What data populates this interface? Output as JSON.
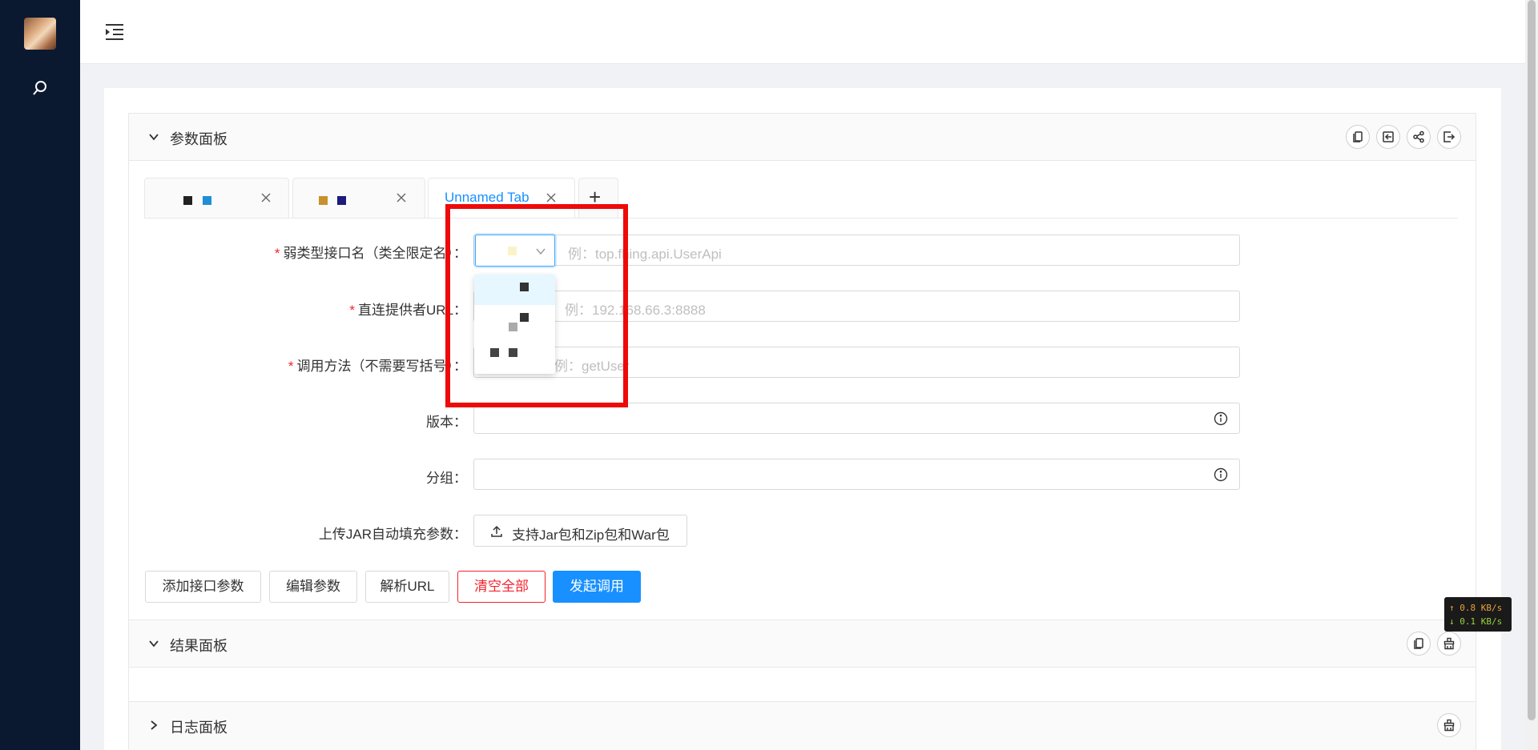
{
  "sidebar": {
    "avatar_alt": "user avatar",
    "search_icon": "search-icon"
  },
  "header": {
    "menu_icon": "menu-indent-icon"
  },
  "param_panel": {
    "title": "参数面板",
    "icons": [
      "copy-icon",
      "import-icon",
      "share-icon",
      "export-icon"
    ],
    "tabs": [
      {
        "label": "",
        "closable": true,
        "masked": true
      },
      {
        "label": "",
        "closable": true,
        "masked": true
      },
      {
        "label": "Unnamed Tab",
        "closable": true,
        "active": true
      }
    ],
    "add_tab_label": "+",
    "fields": {
      "interface": {
        "label": "弱类型接口名（类全限定名）：",
        "required": true,
        "placeholder": "例：top.fhing.api.UserApi",
        "select_value": ""
      },
      "provider_url": {
        "label": "直连提供者URL：",
        "required": true,
        "placeholder": "例：192.168.66.3:8888"
      },
      "method": {
        "label": "调用方法（不需要写括号）：",
        "required": true,
        "placeholder": "例：getUser"
      },
      "version": {
        "label": "版本：",
        "placeholder": ""
      },
      "group": {
        "label": "分组：",
        "placeholder": ""
      },
      "upload": {
        "label": "上传JAR自动填充参数：",
        "button": "支持Jar包和Zip包和War包"
      }
    },
    "dropdown_options": [
      "",
      "",
      ""
    ],
    "buttons": {
      "add_param": "添加接口参数",
      "edit_param": "编辑参数",
      "parse_url": "解析URL",
      "clear_all": "清空全部",
      "invoke": "发起调用"
    }
  },
  "result_panel": {
    "title": "结果面板",
    "icons": [
      "copy-icon",
      "clear-icon"
    ]
  },
  "log_panel": {
    "title": "日志面板",
    "icons": [
      "clear-icon"
    ]
  },
  "net_speed": {
    "up": "↑ 0.8 KB/s",
    "down": "↓ 0.1 KB/s"
  },
  "colors": {
    "sidebar": "#0b1930",
    "primary": "#1890ff",
    "danger": "#f5222d",
    "highlight_box": "#ee0a0a"
  }
}
